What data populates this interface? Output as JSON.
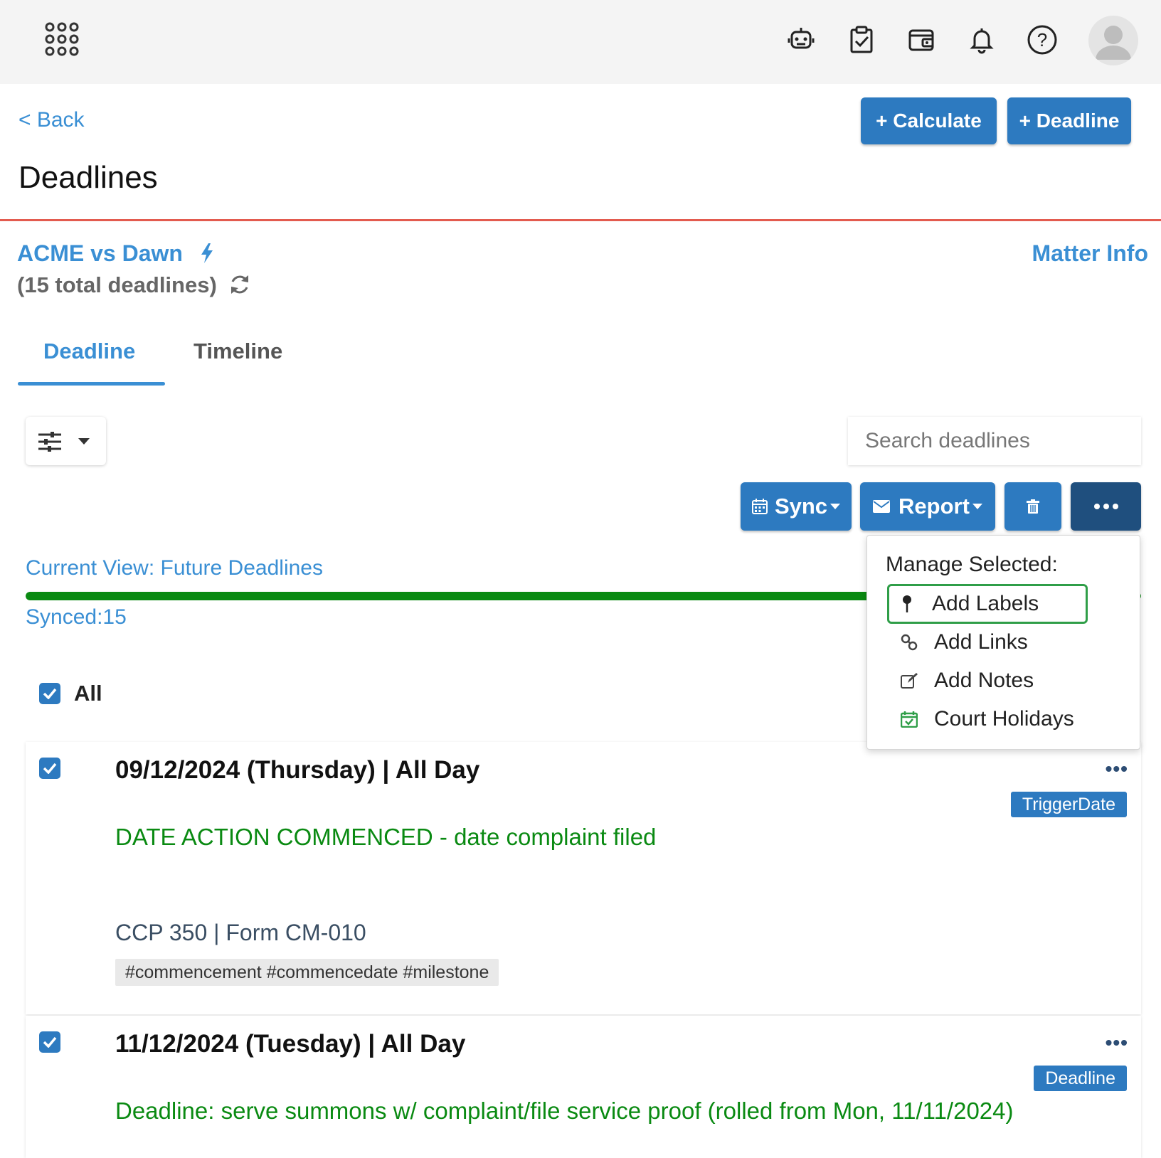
{
  "header": {
    "back_label": "< Back",
    "page_title": "Deadlines",
    "calculate_label": "+ Calculate",
    "deadline_label": "+ Deadline"
  },
  "top_icons": [
    "apps-grid-icon",
    "robot-icon",
    "clipboard-check-icon",
    "wallet-icon",
    "bell-icon",
    "help-icon",
    "user-avatar-icon"
  ],
  "matter": {
    "name": "ACME vs Dawn",
    "total": "(15 total deadlines)",
    "info_link": "Matter Info"
  },
  "tabs": [
    {
      "label": "Deadline",
      "active": true
    },
    {
      "label": "Timeline",
      "active": false
    }
  ],
  "search": {
    "placeholder": "Search deadlines"
  },
  "toolbar": {
    "sync_label": "Sync",
    "report_label": "Report"
  },
  "view": {
    "current_view": "Current View: Future Deadlines",
    "synced": "Synced:15",
    "synced_fraction": 1.0
  },
  "select_all_label": "All",
  "deadlines": [
    {
      "date": "09/12/2024 (Thursday)",
      "time": "All Day",
      "badge": "TriggerDate",
      "description": "DATE ACTION COMMENCED - date complaint filed",
      "rule": "CCP 350",
      "form": "Form CM-010",
      "tags": "#commencement #commencedate #milestone"
    },
    {
      "date": "11/12/2024 (Tuesday)",
      "time": "All Day",
      "badge": "Deadline",
      "description": "Deadline: serve summons w/ complaint/file service proof (rolled from Mon, 11/11/2024)"
    }
  ],
  "manage_menu": {
    "header": "Manage Selected:",
    "items": [
      {
        "label": "Add Labels",
        "icon": "pin-icon"
      },
      {
        "label": "Add Links",
        "icon": "link-icon"
      },
      {
        "label": "Add Notes",
        "icon": "edit-icon"
      },
      {
        "label": "Court Holidays",
        "icon": "calendar-check-icon"
      }
    ]
  },
  "colors": {
    "accent_blue": "#3a8fd4",
    "button_blue": "#2d7ac0",
    "dark_button": "#1f4f7e",
    "progress_green": "#0a8a12",
    "header_rule_red": "#e35b4f",
    "focus_green": "#2f9e48"
  }
}
